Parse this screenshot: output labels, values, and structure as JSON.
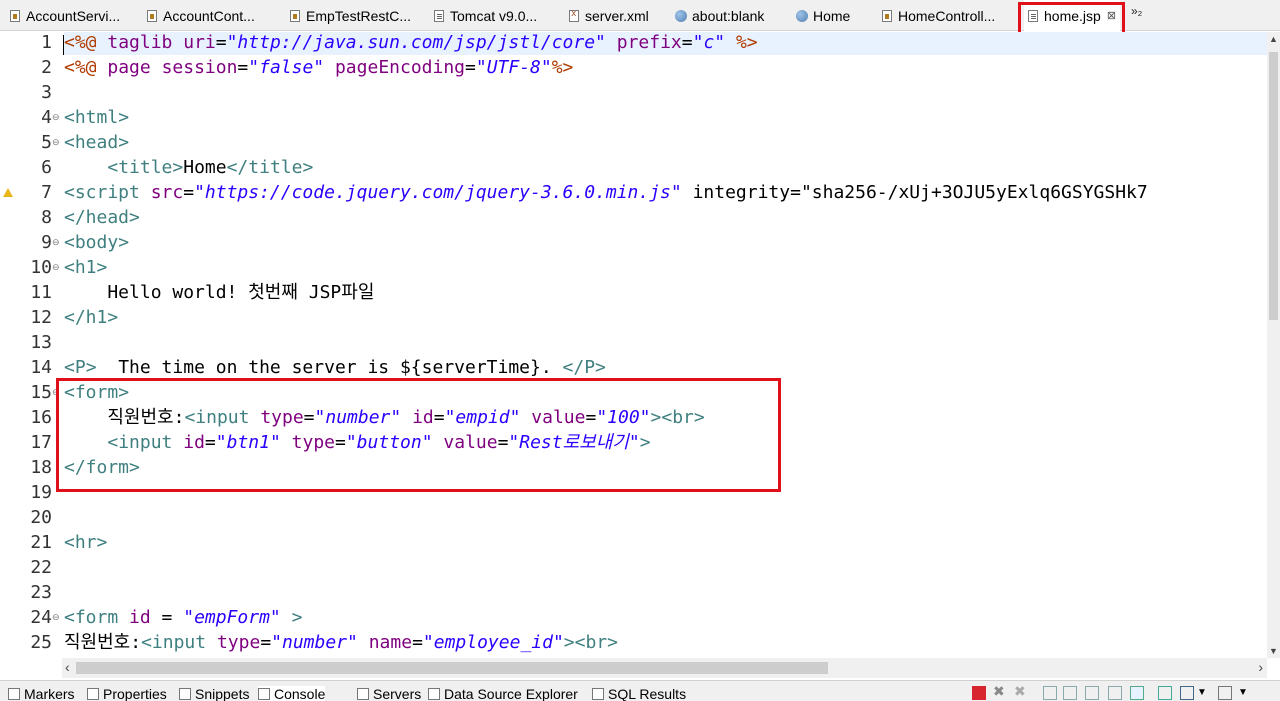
{
  "tabs": [
    {
      "label": "AccountServi...",
      "icon": "java-file-icon"
    },
    {
      "label": "AccountCont...",
      "icon": "java-file-icon"
    },
    {
      "label": "EmpTestRestC...",
      "icon": "java-file-icon"
    },
    {
      "label": "Tomcat v9.0...",
      "icon": "server-file-icon"
    },
    {
      "label": "server.xml",
      "icon": "xml-file-icon"
    },
    {
      "label": "about:blank",
      "icon": "globe-icon"
    },
    {
      "label": "Home",
      "icon": "globe-icon"
    },
    {
      "label": "HomeControll...",
      "icon": "java-file-icon"
    },
    {
      "label": "home.jsp",
      "icon": "jsp-file-icon",
      "active": true
    }
  ],
  "tab_overflow": "»₂",
  "tab_close_glyph": "⊠",
  "editor": {
    "line_numbers": [
      "1",
      "2",
      "3",
      "4",
      "5",
      "6",
      "7",
      "8",
      "9",
      "10",
      "11",
      "12",
      "13",
      "14",
      "15",
      "16",
      "17",
      "18",
      "19",
      "20",
      "21",
      "22",
      "23",
      "24",
      "25"
    ],
    "lines": [
      "<%@ taglib uri=\"http://java.sun.com/jsp/jstl/core\" prefix=\"c\" %>",
      "<%@ page session=\"false\" pageEncoding=\"UTF-8\"%>",
      "",
      "<html>",
      "<head>",
      "    <title>Home</title>",
      "<script src=\"https://code.jquery.com/jquery-3.6.0.min.js\" integrity=\"sha256-/xUj+3OJU5yExlq6GSYGSHk7",
      "</head>",
      "<body>",
      "<h1>",
      "    Hello world! 첫번째 JSP파일",
      "</h1>",
      "",
      "<P>  The time on the server is ${serverTime}. </P>",
      "<form>",
      "    직원번호:<input type=\"number\" id=\"empid\" value=\"100\"><br>",
      "    <input id=\"btn1\" type=\"button\" value=\"Rest로보내기\">",
      "</form>",
      "",
      "",
      "<hr>",
      "",
      "",
      "<form id = \"empForm\" >",
      "직원번호:<input type=\"number\" name=\"employee_id\"><br>"
    ]
  },
  "bottom_views": [
    {
      "label": "Markers"
    },
    {
      "label": "Properties"
    },
    {
      "label": "Snippets"
    },
    {
      "label": "Console",
      "active": true
    },
    {
      "label": "Servers"
    },
    {
      "label": "Data Source Explorer"
    },
    {
      "label": "SQL Results"
    }
  ]
}
